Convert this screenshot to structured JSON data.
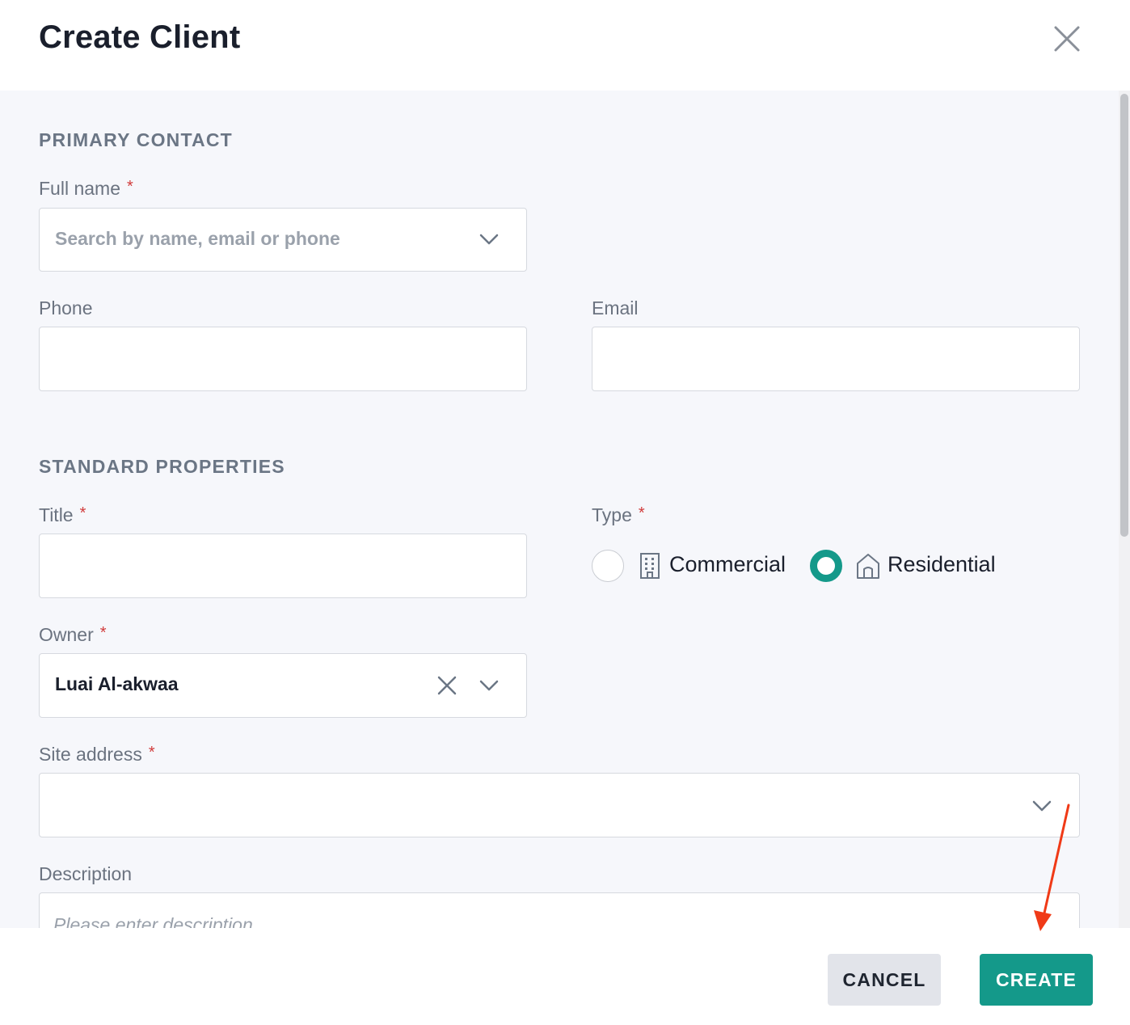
{
  "dialog": {
    "title": "Create Client"
  },
  "primary_contact": {
    "section_title": "PRIMARY CONTACT",
    "full_name": {
      "label": "Full name",
      "required_mark": "*",
      "placeholder": "Search by name, email or phone"
    },
    "phone": {
      "label": "Phone",
      "value": ""
    },
    "email": {
      "label": "Email",
      "value": ""
    }
  },
  "standard_properties": {
    "section_title": "STANDARD PROPERTIES",
    "title_field": {
      "label": "Title",
      "required_mark": "*",
      "value": ""
    },
    "type": {
      "label": "Type",
      "required_mark": "*",
      "options": [
        {
          "label": "Commercial",
          "icon": "building-icon",
          "selected": false
        },
        {
          "label": "Residential",
          "icon": "house-icon",
          "selected": true
        }
      ]
    },
    "owner": {
      "label": "Owner",
      "required_mark": "*",
      "value": "Luai Al-akwaa"
    },
    "site_address": {
      "label": "Site address",
      "required_mark": "*",
      "value": ""
    },
    "description": {
      "label": "Description",
      "placeholder": "Please enter description"
    }
  },
  "footer": {
    "cancel_label": "CANCEL",
    "create_label": "CREATE"
  },
  "colors": {
    "accent": "#14998a",
    "required": "#d13b3b",
    "annotation_arrow": "#f03a17"
  }
}
